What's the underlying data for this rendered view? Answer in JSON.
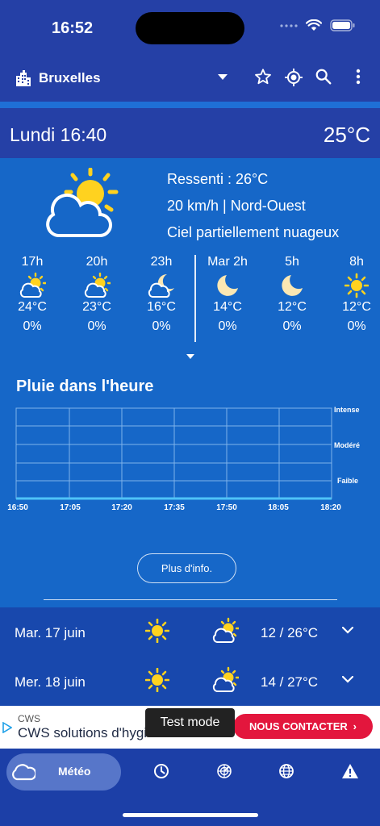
{
  "status_bar": {
    "time": "16:52"
  },
  "app_bar": {
    "city": "Bruxelles",
    "icons": [
      "city-icon",
      "dropdown-icon",
      "star-icon",
      "location-icon",
      "search-icon",
      "more-icon"
    ]
  },
  "current": {
    "day_time": "Lundi 16:40",
    "temperature": "25°C",
    "feels_like": "Ressenti : 26°C",
    "wind": "20 km/h | Nord-Ouest",
    "condition": "Ciel partiellement nuageux"
  },
  "hourly": [
    {
      "hour": "17h",
      "icon": "sun-cloud",
      "temp": "24°C",
      "precip": "0%"
    },
    {
      "hour": "20h",
      "icon": "sun-cloud",
      "temp": "23°C",
      "precip": "0%"
    },
    {
      "hour": "23h",
      "icon": "moon-cloud",
      "temp": "16°C",
      "precip": "0%"
    },
    {
      "hour": "Mar 2h",
      "icon": "moon",
      "temp": "14°C",
      "precip": "0%"
    },
    {
      "hour": "5h",
      "icon": "moon",
      "temp": "12°C",
      "precip": "0%"
    },
    {
      "hour": "8h",
      "icon": "sun",
      "temp": "12°C",
      "precip": "0%"
    }
  ],
  "rain": {
    "title": "Pluie dans l'heure",
    "levels": [
      "Intense",
      "Modéré",
      "Faible"
    ],
    "times": [
      "16:50",
      "17:05",
      "17:20",
      "17:35",
      "17:50",
      "18:05",
      "18:20"
    ]
  },
  "more_info_label": "Plus d'info.",
  "forecast": [
    {
      "day": "Mar. 17 juin",
      "icon_day": "sun",
      "icon_night": "sun-cloud",
      "temp": "12 / 26°C"
    },
    {
      "day": "Mer. 18 juin",
      "icon_day": "sun",
      "icon_night": "sun-cloud",
      "temp": "14 / 27°C"
    }
  ],
  "ad": {
    "brand": "CWS",
    "title": "CWS solutions d'hygiène",
    "cta": "NOUS CONTACTER",
    "test_mode": "Test mode"
  },
  "nav": {
    "active_label": "Météo",
    "items": [
      "cloud-icon",
      "clock-icon",
      "radar-icon",
      "globe-icon",
      "warning-icon"
    ]
  },
  "colors": {
    "header": "#2540a6",
    "panel": "#1667c8",
    "forecast": "#1848ad",
    "sun": "#ffd21f",
    "ad_button": "#e3163d"
  }
}
